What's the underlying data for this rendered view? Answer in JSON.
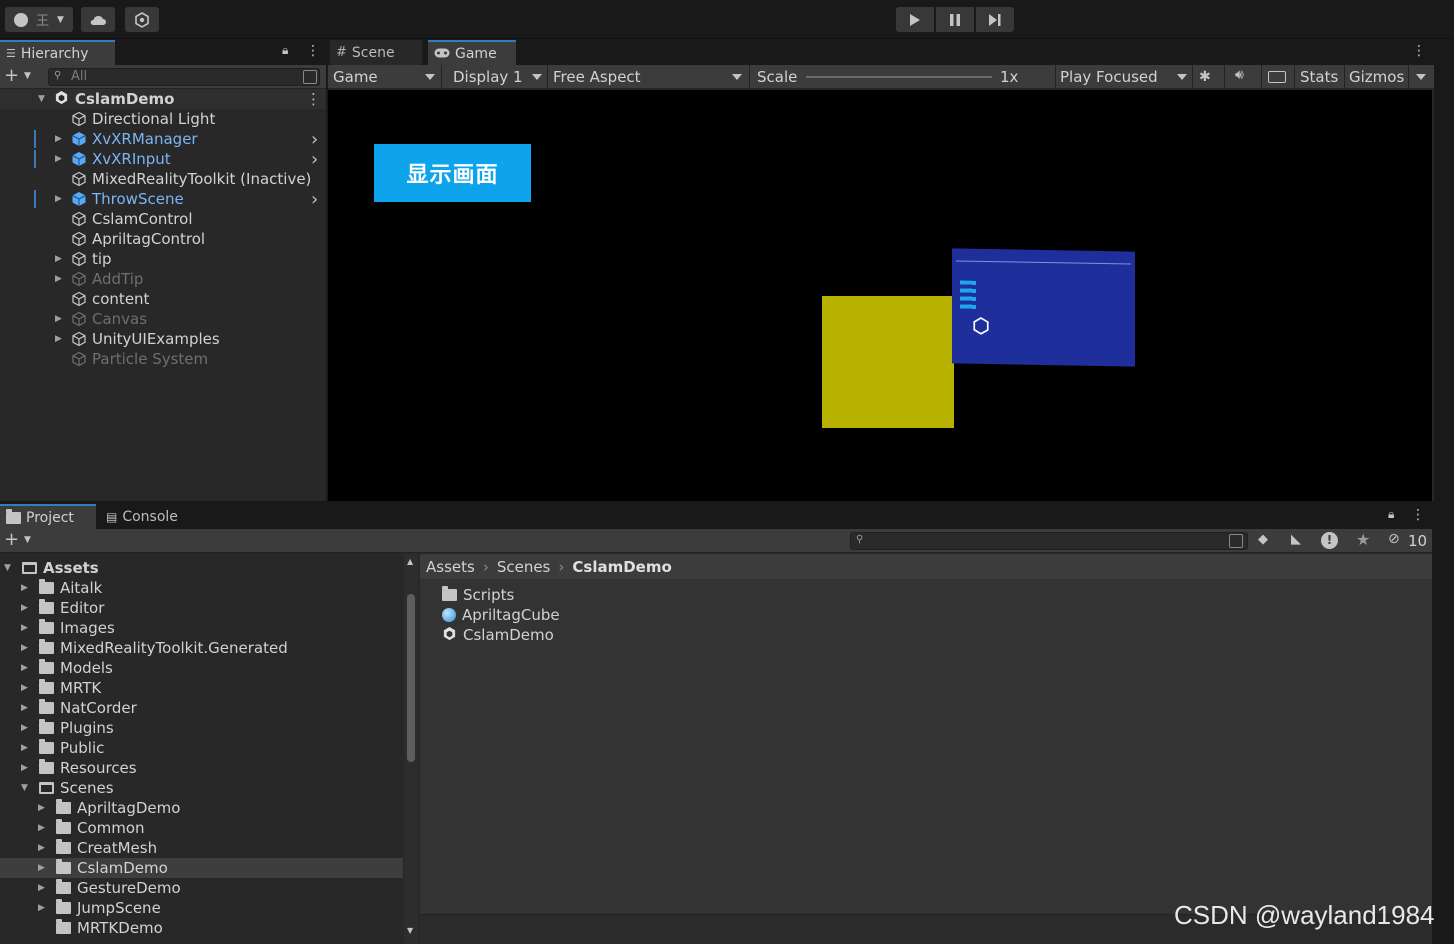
{
  "toolbar": {
    "account_label": "王",
    "play_label": "Play",
    "pause_label": "Pause",
    "step_label": "Step"
  },
  "hierarchy": {
    "tab_label": "Hierarchy",
    "search_placeholder": "All",
    "scene_name": "CslamDemo",
    "items": [
      {
        "label": "Directional Light"
      },
      {
        "label": "XvXRManager"
      },
      {
        "label": "XvXRInput"
      },
      {
        "label": "MixedRealityToolkit (Inactive)"
      },
      {
        "label": "ThrowScene"
      },
      {
        "label": "CslamControl"
      },
      {
        "label": "ApriltagControl"
      },
      {
        "label": "tip"
      },
      {
        "label": "AddTip"
      },
      {
        "label": "content"
      },
      {
        "label": "Canvas"
      },
      {
        "label": "UnityUIExamples"
      },
      {
        "label": "Particle System"
      }
    ]
  },
  "game": {
    "tabs": [
      {
        "label": "Scene"
      },
      {
        "label": "Game"
      }
    ],
    "mode": "Game",
    "display": "Display 1",
    "aspect": "Free Aspect",
    "scale_label": "Scale",
    "scale_value": "1x",
    "play_mode": "Play Focused",
    "stats_label": "Stats",
    "gizmos_label": "Gizmos",
    "show_button": "显示画面"
  },
  "project": {
    "tabs": [
      {
        "label": "Project"
      },
      {
        "label": "Console"
      }
    ],
    "hidden_count": "10",
    "tree": [
      {
        "label": "Assets"
      },
      {
        "label": "Aitalk"
      },
      {
        "label": "Editor"
      },
      {
        "label": "Images"
      },
      {
        "label": "MixedRealityToolkit.Generated"
      },
      {
        "label": "Models"
      },
      {
        "label": "MRTK"
      },
      {
        "label": "NatCorder"
      },
      {
        "label": "Plugins"
      },
      {
        "label": "Public"
      },
      {
        "label": "Resources"
      },
      {
        "label": "Scenes"
      },
      {
        "label": "ApriltagDemo"
      },
      {
        "label": "Common"
      },
      {
        "label": "CreatMesh"
      },
      {
        "label": "CslamDemo"
      },
      {
        "label": "GestureDemo"
      },
      {
        "label": "JumpScene"
      },
      {
        "label": "MRTKDemo"
      }
    ],
    "breadcrumb": [
      "Assets",
      "Scenes",
      "CslamDemo"
    ],
    "content": [
      {
        "label": "Scripts"
      },
      {
        "label": "ApriltagCube"
      },
      {
        "label": "CslamDemo"
      }
    ]
  },
  "watermark": "CSDN @wayland1984",
  "colors": {
    "accent": "#3a79bb",
    "prefab": "#7cb4f5",
    "button": "#0ea4ec"
  }
}
